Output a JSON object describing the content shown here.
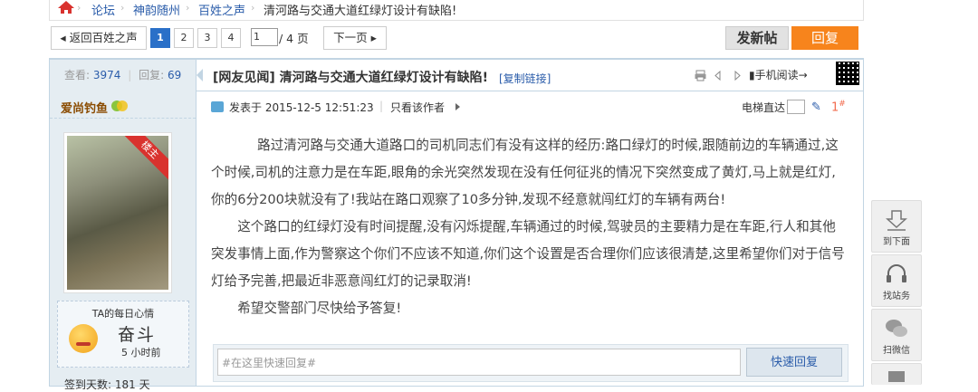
{
  "breadcrumb": {
    "items": [
      "论坛",
      "神韵随州",
      "百姓之声"
    ],
    "current": "清河路与交通大道红绿灯设计有缺陷!"
  },
  "pager": {
    "back_label": "返回百姓之声",
    "pages": [
      "1",
      "2",
      "3",
      "4"
    ],
    "current_page": "1",
    "input_value": "1",
    "total_label": "/ 4 页",
    "next_label": "下一页"
  },
  "actions": {
    "new_post_label": "发新帖",
    "reply_label": "回复"
  },
  "stats": {
    "views_label": "查看:",
    "views": "3974",
    "replies_label": "回复:",
    "replies": "69"
  },
  "author": {
    "name": "爱尚钓鱼",
    "badge": "楼主",
    "mood_title": "TA的每日心情",
    "mood_value": "奋斗",
    "mood_time": "5 小时前",
    "sign_days": "签到天数: 181 天"
  },
  "thread": {
    "title": "[网友见闻] 清河路与交通大道红绿灯设计有缺陷!",
    "copy_link": "[复制链接]",
    "mobile_read": "手机阅读",
    "posted_at": "发表于 2015-12-5 12:51:23",
    "only_author": "只看该作者",
    "jump_label": "电梯直达",
    "floor": "1",
    "floor_sup": "#"
  },
  "content": {
    "paragraphs": [
      "路过清河路与交通大道路口的司机同志们有没有这样的经历:路口绿灯的时候,跟随前边的车辆通过,这个时候,司机的注意力是在车距,眼角的余光突然发现在没有任何征兆的情况下突然变成了黄灯,马上就是红灯,你的6分200块就没有了!我站在路口观察了10多分钟,发现不经意就闯红灯的车辆有两台!",
      "这个路口的红绿灯没有时间提醒,没有闪烁提醒,车辆通过的时候,驾驶员的主要精力是在车距,行人和其他突发事情上面,作为警察这个你们不应该不知道,你们这个设置是否合理你们应该很清楚,这里希望你们对于信号灯给予完善,把最近非恶意闯红灯的记录取消!",
      "希望交警部门尽快给予答复!"
    ]
  },
  "quick_reply": {
    "placeholder": "#在这里快速回复#",
    "button_label": "快速回复"
  },
  "float_bar": {
    "items": [
      "到下面",
      "找站务",
      "扫微信"
    ]
  },
  "colors": {
    "accent_blue": "#2a70c8",
    "reply_orange": "#f7841c",
    "floor_red": "#f26c4f"
  }
}
